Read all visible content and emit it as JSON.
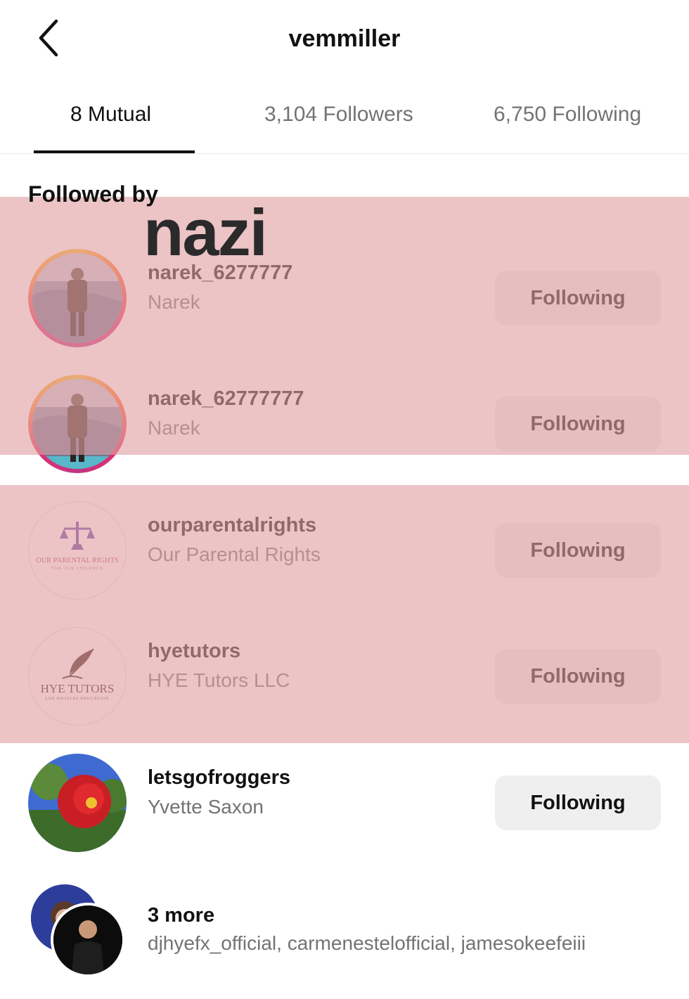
{
  "header": {
    "title": "vemmiller",
    "back_icon": "chevron-left-icon"
  },
  "tabs": [
    {
      "label": "8 Mutual",
      "active": true
    },
    {
      "label": "3,104 Followers",
      "active": false
    },
    {
      "label": "6,750 Following",
      "active": false
    }
  ],
  "section": {
    "title": "Followed by"
  },
  "annotation": {
    "text": "nazi",
    "overlay_color": "#e0a0a3"
  },
  "users": [
    {
      "username": "narek_6277777",
      "fullname": "Narek",
      "button": "Following"
    },
    {
      "username": "narek_62777777",
      "fullname": "Narek",
      "button": "Following"
    },
    {
      "username": "ourparentalrights",
      "fullname": "Our Parental Rights",
      "button": "Following",
      "logo_text": "OUR PARENTAL RIGHTS",
      "logo_subtext": "FOR OUR CHILDREN"
    },
    {
      "username": "hyetutors",
      "fullname": "HYE Tutors LLC",
      "button": "Following",
      "logo_text": "HYE TUTORS",
      "logo_subtext": "LOS ANGELES EDUCATION"
    },
    {
      "username": "letsgofroggers",
      "fullname": "Yvette Saxon",
      "button": "Following"
    }
  ],
  "more": {
    "title": "3 more",
    "names": "djhyefx_official, carmenestelofficial, jamesokeefeiii"
  }
}
